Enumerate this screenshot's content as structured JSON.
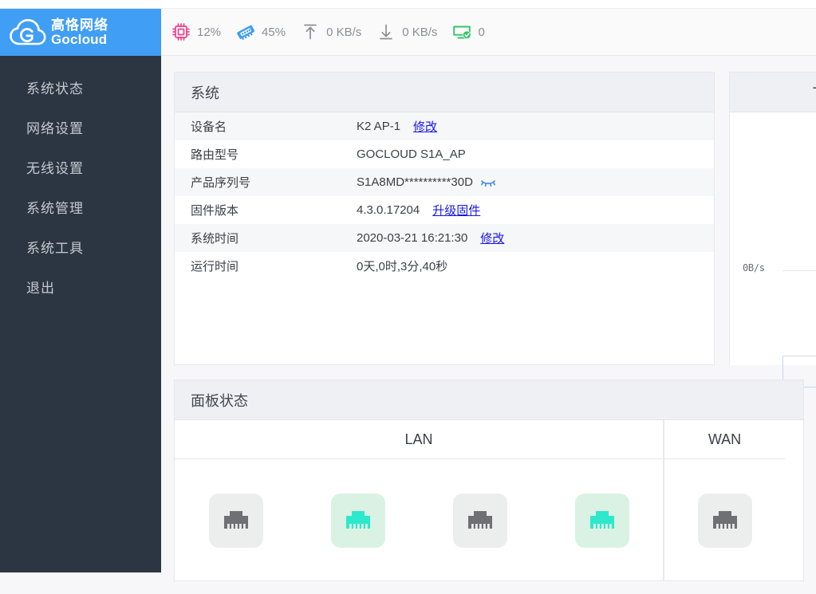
{
  "brand": {
    "name_cn": "高恪网络",
    "name_en": "Gocloud",
    "registered_mark": "®",
    "logo_icon": "cloud-g-logo-icon",
    "blue": "#409ef4"
  },
  "header": {
    "stats": [
      {
        "icon": "cpu-chip-icon",
        "label": "cpu",
        "value": "12%",
        "color": "#ef3f8e"
      },
      {
        "icon": "memory-ram-icon",
        "label": "memory",
        "value": "45%",
        "color": "#3f9ef0"
      },
      {
        "icon": "upload-arrow-icon",
        "label": "upload",
        "value": "0 KB/s",
        "color": "#8b8e95"
      },
      {
        "icon": "download-arrow-icon",
        "label": "download",
        "value": "0 KB/s",
        "color": "#8b8e95"
      },
      {
        "icon": "device-online-icon",
        "label": "devices",
        "value": "0",
        "color": "#32c76a"
      }
    ]
  },
  "sidebar": {
    "items": [
      {
        "label": "系统状态",
        "name": "system-status"
      },
      {
        "label": "网络设置",
        "name": "network-settings"
      },
      {
        "label": "无线设置",
        "name": "wireless-settings"
      },
      {
        "label": "系统管理",
        "name": "system-management"
      },
      {
        "label": "系统工具",
        "name": "system-tools"
      },
      {
        "label": "退出",
        "name": "logout"
      }
    ]
  },
  "system_card": {
    "title": "系统",
    "rows": [
      {
        "key": "设备名",
        "value": "K2 AP-1",
        "link": "修改",
        "eye": false
      },
      {
        "key": "路由型号",
        "value": "GOCLOUD S1A_AP",
        "link": "",
        "eye": false
      },
      {
        "key": "产品序列号",
        "value": "S1A8MD**********30D",
        "link": "",
        "eye": true
      },
      {
        "key": "固件版本",
        "value": "4.3.0.17204",
        "link": "升级固件",
        "eye": false
      },
      {
        "key": "系统时间",
        "value": "2020-03-21 16:21:30",
        "link": "修改",
        "eye": false
      },
      {
        "key": "运行时间",
        "value": "0天,0时,3分,40秒",
        "link": "",
        "eye": false
      }
    ],
    "eye_icon": "eye-slash-icon"
  },
  "top_terminal_card": {
    "title": "Top 终端",
    "axis_label": "0B/s"
  },
  "panel_card": {
    "title": "面板状态",
    "groups": [
      {
        "name": "lan",
        "title": "LAN",
        "ports": [
          {
            "icon": "rj45-port-icon",
            "state": "off"
          },
          {
            "icon": "rj45-port-icon",
            "state": "on"
          },
          {
            "icon": "rj45-port-icon",
            "state": "off"
          },
          {
            "icon": "rj45-port-icon",
            "state": "on"
          }
        ]
      },
      {
        "name": "wan",
        "title": "WAN",
        "ports": [
          {
            "icon": "rj45-port-icon",
            "state": "off"
          }
        ]
      }
    ],
    "port_color_on": "#2ee8cb",
    "port_color_off": "#6e7073"
  }
}
